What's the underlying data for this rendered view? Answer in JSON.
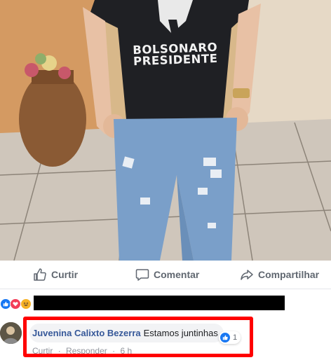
{
  "photo": {
    "shirt_line1": "BOLSONARO",
    "shirt_line2": "PRESIDENTE"
  },
  "actions": {
    "like_label": "Curtir",
    "comment_label": "Comentar",
    "share_label": "Compartilhar"
  },
  "reactions": [
    "like-icon",
    "love-icon",
    "haha-icon"
  ],
  "comment": {
    "author": "Juvenina Calixto Bezerra",
    "text": "Estamos juntinhas",
    "like_count": "1",
    "like_action": "Curtir",
    "separator": "·",
    "reply_action": "Responder",
    "time": "6 h"
  },
  "colors": {
    "link": "#365899",
    "meta": "#90949c",
    "highlight": "#ff0000",
    "fb_blue": "#1877f2"
  }
}
